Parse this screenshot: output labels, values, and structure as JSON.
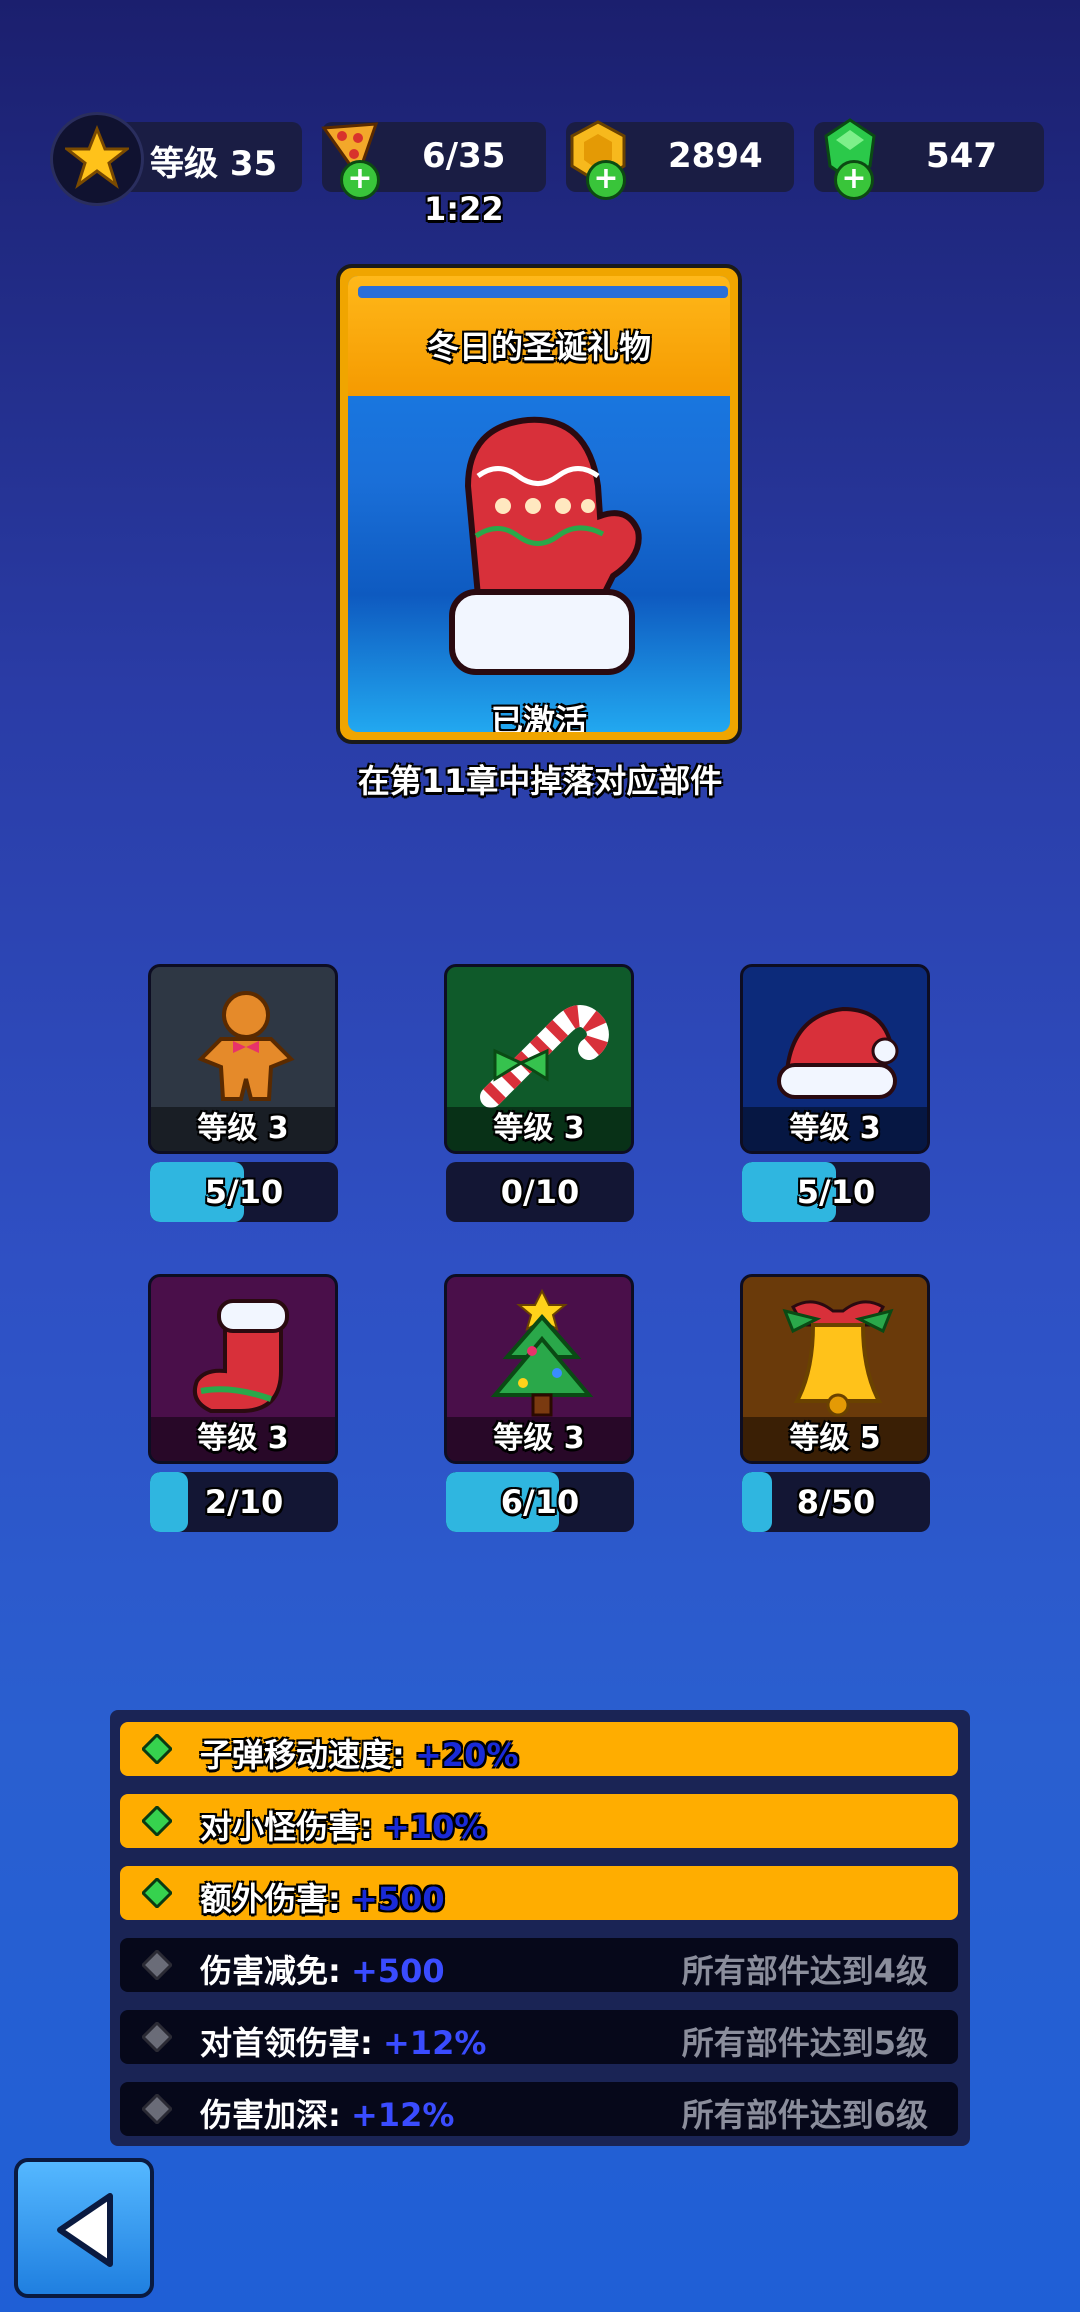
{
  "top_bar": {
    "level_label": "等级 35",
    "energy": "6/35",
    "energy_timer": "1:22",
    "coins": "2894",
    "gems": "547",
    "icons": [
      "star-icon",
      "pizza-energy-icon",
      "coin-icon",
      "gem-icon"
    ]
  },
  "feature": {
    "title": "冬日的圣诞礼物",
    "status": "已激活",
    "drop_hint": "在第11章中掉落对应部件"
  },
  "parts": [
    {
      "name": "gingerbread-man",
      "level": "等级 3",
      "progress": "5/10",
      "fraction": 0.5
    },
    {
      "name": "candy-cane",
      "level": "等级 3",
      "progress": "0/10",
      "fraction": 0.0
    },
    {
      "name": "santa-hat",
      "level": "等级 3",
      "progress": "5/10",
      "fraction": 0.5
    },
    {
      "name": "christmas-stocking",
      "level": "等级 3",
      "progress": "2/10",
      "fraction": 0.2
    },
    {
      "name": "christmas-tree",
      "level": "等级 3",
      "progress": "6/10",
      "fraction": 0.6
    },
    {
      "name": "jingle-bell",
      "level": "等级 5",
      "progress": "8/50",
      "fraction": 0.16
    }
  ],
  "bonuses": [
    {
      "label": "子弹移动速度:",
      "value": "+20%",
      "active": true,
      "requirement": ""
    },
    {
      "label": "对小怪伤害:",
      "value": "+10%",
      "active": true,
      "requirement": ""
    },
    {
      "label": "额外伤害:",
      "value": "+500",
      "active": true,
      "requirement": ""
    },
    {
      "label": "伤害减免:",
      "value": "+500",
      "active": false,
      "requirement": "所有部件达到4级"
    },
    {
      "label": "对首领伤害:",
      "value": "+12%",
      "active": false,
      "requirement": "所有部件达到5级"
    },
    {
      "label": "伤害加深:",
      "value": "+12%",
      "active": false,
      "requirement": "所有部件达到6级"
    }
  ],
  "colors": {
    "active_row": "#ffad00",
    "inactive_row": "#06081a",
    "progress_fill": "#2fb6e0"
  }
}
